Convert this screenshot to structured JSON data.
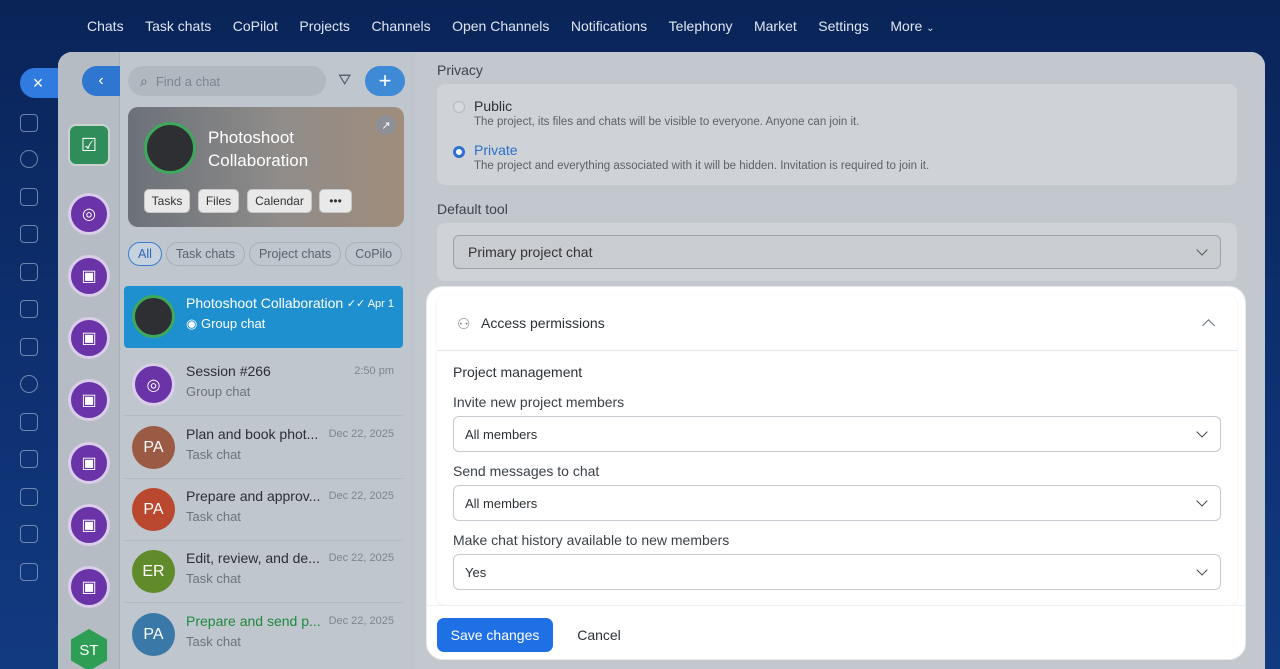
{
  "topnav": [
    "Chats",
    "Task chats",
    "CoPilot",
    "Projects",
    "Channels",
    "Open Channels",
    "Notifications",
    "Telephony",
    "Market",
    "Settings",
    "More"
  ],
  "chatpanel": {
    "search_placeholder": "Find a chat",
    "card": {
      "title": "Photoshoot Collaboration",
      "chips": [
        "Tasks",
        "Files",
        "Calendar",
        "•••"
      ]
    },
    "filters": [
      "All",
      "Task chats",
      "Project chats",
      "CoPilo"
    ],
    "chats": [
      {
        "title": "Photoshoot Collaboration",
        "subtitle": "Group chat",
        "date": "Apr 1",
        "selected": true,
        "avatar": "photo",
        "color": "#2e2f33"
      },
      {
        "title": "Session #266",
        "subtitle": "Group chat",
        "date": "2:50 pm",
        "avatar": "copilot",
        "color": "#6a34a8"
      },
      {
        "title": "Plan and book phot...",
        "subtitle": "Task chat",
        "date": "Dec 22, 2025",
        "initials": "PA",
        "color": "#9a5a43"
      },
      {
        "title": "Prepare and approv...",
        "subtitle": "Task chat",
        "date": "Dec 22, 2025",
        "initials": "PA",
        "color": "#b9482f"
      },
      {
        "title": "Edit, review, and de...",
        "subtitle": "Task chat",
        "date": "Dec 22, 2025",
        "initials": "ER",
        "color": "#5f8b2a"
      },
      {
        "title": "Prepare and send p...",
        "subtitle": "Task chat",
        "date": "Dec 22, 2025",
        "initials": "PA",
        "color": "#3a78a8",
        "title_color": "#1e8a3f"
      }
    ]
  },
  "avatars_col": {
    "last_initials": "ST"
  },
  "settings": {
    "privacy_label": "Privacy",
    "public_label": "Public",
    "public_desc": "The project, its files and chats will be visible to everyone. Anyone can join it.",
    "private_label": "Private",
    "private_desc": "The project and everything associated with it will be hidden. Invitation is required to join it.",
    "default_tool_label": "Default tool",
    "default_tool_value": "Primary project chat"
  },
  "access": {
    "title": "Access permissions",
    "section": "Project management",
    "fields": [
      {
        "label": "Invite new project members",
        "value": "All members"
      },
      {
        "label": "Send messages to chat",
        "value": "All members"
      },
      {
        "label": "Make chat history available to new members",
        "value": "Yes"
      }
    ],
    "save_label": "Save changes",
    "cancel_label": "Cancel"
  }
}
